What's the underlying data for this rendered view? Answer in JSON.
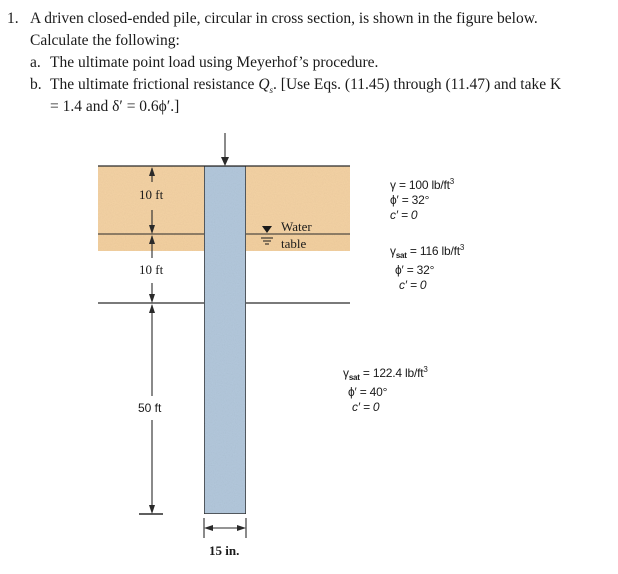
{
  "question": {
    "number": "1.",
    "intro_line1": "A driven closed-ended pile, circular in cross section, is shown in the figure below.",
    "intro_line2": "Calculate the following:",
    "parts": [
      {
        "label": "a.",
        "text": "The ultimate point load using Meyerhof’s procedure."
      },
      {
        "label": "b.",
        "text_before": "The ultimate frictional resistance ",
        "symbol": "Q",
        "subscript": "s",
        "text_after": ". [Use Eqs. (11.45) through (11.47) and take K",
        "line2": "= 1.4 and δ′ = 0.6ϕ′.]"
      }
    ]
  },
  "figure": {
    "load_arrow": "downward-arrow",
    "dimensions": {
      "layer1_depth": "10 ft",
      "layer2_depth": "10 ft",
      "layer3_depth": "50 ft",
      "pile_diameter": "15 in."
    },
    "water_table": {
      "line1": "Water",
      "line2": "table",
      "icon": "water-table-symbol"
    },
    "layers": [
      {
        "gamma_symbol": "γ",
        "gamma_sub": "",
        "gamma_value": "= 100 lb/ft",
        "phi": "ϕ′ = 32°",
        "c": "c′ = 0"
      },
      {
        "gamma_symbol": "γ",
        "gamma_sub": "sat",
        "gamma_value": "= 116 lb/ft",
        "phi": "ϕ′ = 32°",
        "c": "c′ = 0"
      },
      {
        "gamma_symbol": "γ",
        "gamma_sub": "sat",
        "gamma_value": "= 122.4 lb/ft",
        "phi": "ϕ′ = 40°",
        "c": "c′ = 0"
      }
    ],
    "unit_exponent": "3",
    "colors": {
      "sand": "#f3d3a6",
      "sand_light": "#f6dcb6",
      "pile": "#b3c9de",
      "line": "#2a2a2a"
    }
  }
}
